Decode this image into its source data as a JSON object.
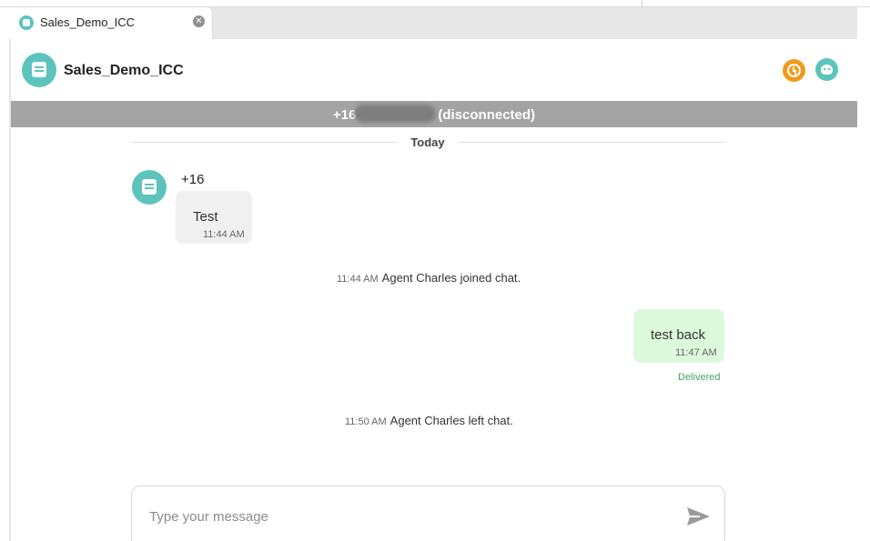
{
  "tab": {
    "label": "Sales_Demo_ICC",
    "close_glyph": "✕",
    "icon": "chat-bubble-icon"
  },
  "header": {
    "title": "Sales_Demo_ICC",
    "actions": [
      "timer-icon",
      "bot-icon"
    ]
  },
  "status": {
    "number_prefix": "+16",
    "state": "(disconnected)"
  },
  "conversation": {
    "date_label": "Today",
    "incoming": {
      "sender": "+16",
      "text": "Test",
      "time": "11:44 AM"
    },
    "events": [
      {
        "time": "11:44 AM",
        "text": "Agent Charles joined chat."
      },
      {
        "time": "11:50 AM",
        "text": "Agent Charles left chat."
      }
    ],
    "outgoing": {
      "text": "test back",
      "time": "11:47 AM",
      "status": "Delivered"
    }
  },
  "composer": {
    "placeholder": "Type your message",
    "value": ""
  },
  "colors": {
    "accent": "#5cc3bd",
    "timer": "#f19a1a",
    "status_bar": "#a3a3a3",
    "outgoing_bubble": "#dcfadb",
    "incoming_bubble": "#f0f0f0",
    "delivered": "#3fa861"
  }
}
